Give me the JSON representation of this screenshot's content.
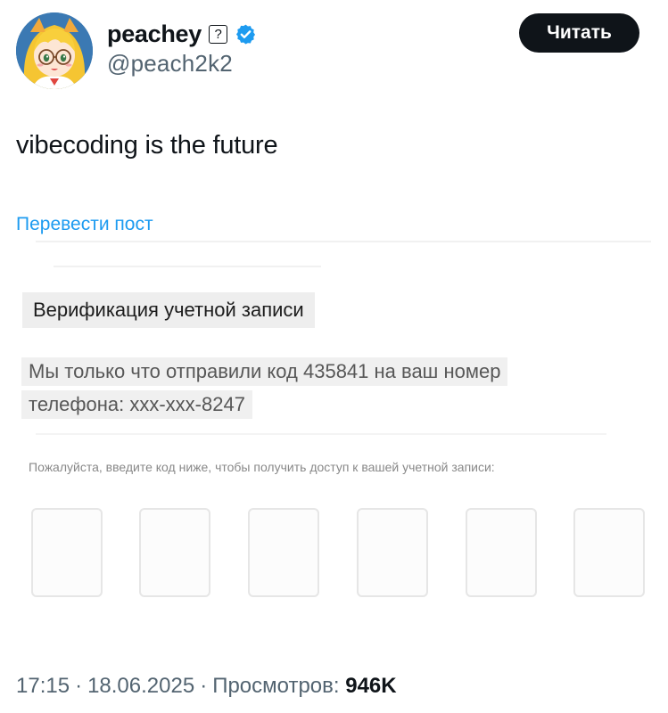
{
  "author": {
    "display_name": "peachey",
    "help_badge": "?",
    "handle": "@peach2k2",
    "verified": true,
    "verified_color": "#1d9bf0"
  },
  "follow_button": {
    "label": "Читать"
  },
  "tweet": {
    "text": "vibecoding is the future",
    "translate_link": "Перевести пост"
  },
  "embedded_screenshot": {
    "title": "Верификация учетной записи",
    "message_line_1": "Мы только что отправили код 435841 на ваш номер",
    "message_line_2": "телефона: xxx-xxx-8247",
    "instructions": "Пожалуйста, введите код ниже, чтобы получить доступ к вашей учетной записи:",
    "code_boxes": [
      "",
      "",
      "",
      "",
      "",
      ""
    ]
  },
  "meta": {
    "time": "17:15",
    "separator": "·",
    "date": "18.06.2025",
    "views_label": "Просмотров:",
    "views_count": "946K"
  },
  "colors": {
    "text_primary": "#0f1419",
    "text_secondary": "#536471",
    "link": "#1d9bf0",
    "button_bg": "#0f1419"
  }
}
